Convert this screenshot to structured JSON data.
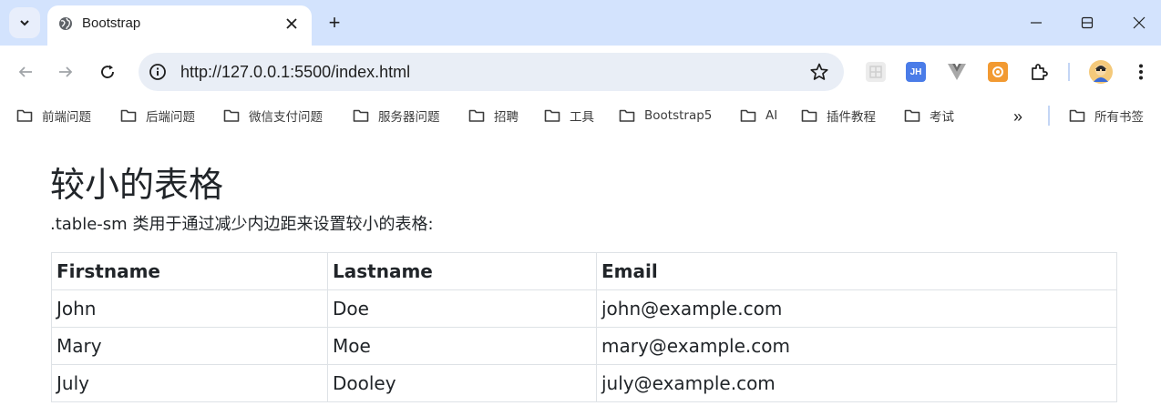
{
  "browser": {
    "tab_title": "Bootstrap",
    "new_tab_symbol": "+",
    "url": "http://127.0.0.1:5500/index.html",
    "extensions": [
      {
        "name": "grid-extension-icon",
        "label": "",
        "color": "#e6e6e6"
      },
      {
        "name": "jh-extension-icon",
        "label": "JH",
        "color": "#4a7ce8"
      },
      {
        "name": "vue-extension-icon",
        "label": "",
        "color": "#9e9e9e"
      },
      {
        "name": "orange-extension-icon",
        "label": "",
        "color": "#f29a32"
      }
    ]
  },
  "bookmarks": {
    "items": [
      {
        "label": "前端问题"
      },
      {
        "label": "后端问题"
      },
      {
        "label": "微信支付问题"
      },
      {
        "label": "服务器问题"
      },
      {
        "label": "招聘"
      },
      {
        "label": "工具"
      },
      {
        "label": "Bootstrap5"
      },
      {
        "label": "AI"
      },
      {
        "label": "插件教程"
      },
      {
        "label": "考试"
      }
    ],
    "more_symbol": "»",
    "all_bookmarks": "所有书签"
  },
  "page": {
    "title": "较小的表格",
    "description": ".table-sm 类用于通过减少内边距来设置较小的表格:",
    "table": {
      "headers": [
        "Firstname",
        "Lastname",
        "Email"
      ],
      "rows": [
        [
          "John",
          "Doe",
          "john@example.com"
        ],
        [
          "Mary",
          "Moe",
          "mary@example.com"
        ],
        [
          "July",
          "Dooley",
          "july@example.com"
        ]
      ]
    }
  }
}
